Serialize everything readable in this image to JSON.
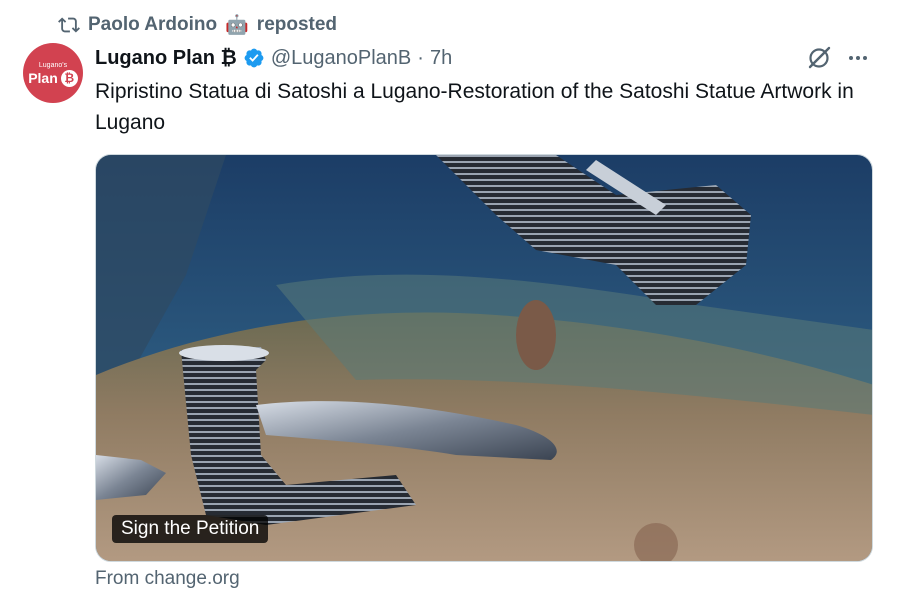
{
  "repost": {
    "icon": "repost-icon",
    "user": "Paolo Ardoino",
    "emoji": "🤖",
    "action": "reposted"
  },
  "tweet": {
    "author_name": "Lugano Plan ₿",
    "verified": true,
    "handle": "@LuganoPlanB",
    "separator": "·",
    "time": "7h",
    "text": "Ripristino Statua di Satoshi a Lugano-Restoration of the Satoshi Statue Artwork in Lugano"
  },
  "avatar": {
    "line1": "Lugano's",
    "line2": "Plan",
    "symbol": "₿",
    "bg_color": "#d24250"
  },
  "card": {
    "label": "Sign the Petition",
    "source": "From change.org",
    "image_alt": "Broken Satoshi statue pieces on a lake shore"
  },
  "colors": {
    "accent": "#1d9bf0",
    "secondary_text": "#536471",
    "brand": "#d24250"
  }
}
